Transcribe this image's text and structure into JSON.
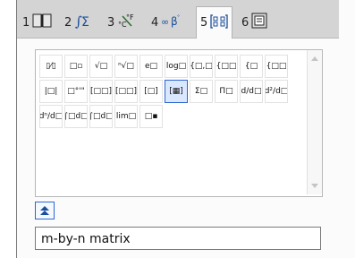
{
  "tabs": [
    {
      "number": "1",
      "icon": "book-icon"
    },
    {
      "number": "2",
      "icon": "integral-sum-icon"
    },
    {
      "number": "3",
      "icon": "unit-conversion-icon"
    },
    {
      "number": "4",
      "icon": "infinity-beta-icon"
    },
    {
      "number": "5",
      "icon": "matrix-template-icon",
      "active": true
    },
    {
      "number": "6",
      "icon": "catalog-icon"
    }
  ],
  "templates": [
    {
      "name": "fraction-template",
      "glyph": "▯⁄▯"
    },
    {
      "name": "exponent-template",
      "glyph": "□▫"
    },
    {
      "name": "square-root-template",
      "glyph": "√□"
    },
    {
      "name": "nth-root-template",
      "glyph": "ⁿ√□"
    },
    {
      "name": "e-exponent-template",
      "glyph": "e□"
    },
    {
      "name": "log-template",
      "glyph": "log□"
    },
    {
      "name": "piecewise-2-template",
      "glyph": "{□,□"
    },
    {
      "name": "piecewise-n-template",
      "glyph": "{□□"
    },
    {
      "name": "system-2-template",
      "glyph": "{□"
    },
    {
      "name": "system-n-template",
      "glyph": "{□□"
    },
    {
      "name": "absolute-value-template",
      "glyph": "|□|"
    },
    {
      "name": "dms-template",
      "glyph": "□°'\""
    },
    {
      "name": "matrix-2x2-template",
      "glyph": "[□□]"
    },
    {
      "name": "row-vector-template",
      "glyph": "[□□]"
    },
    {
      "name": "column-vector-template",
      "glyph": "[□]"
    },
    {
      "name": "matrix-m-by-n-template",
      "glyph": "[▦]",
      "selected": true
    },
    {
      "name": "sum-template",
      "glyph": "Σ□"
    },
    {
      "name": "product-template",
      "glyph": "Π□"
    },
    {
      "name": "first-derivative-template",
      "glyph": "d/d□"
    },
    {
      "name": "second-derivative-template",
      "glyph": "d²/d□"
    },
    {
      "name": "nth-derivative-template",
      "glyph": "dⁿ/d□"
    },
    {
      "name": "definite-integral-template",
      "glyph": "∫□d□"
    },
    {
      "name": "indefinite-integral-template",
      "glyph": "∫□d□"
    },
    {
      "name": "limit-template",
      "glyph": "lim□"
    },
    {
      "name": "subscript-template",
      "glyph": "□▪"
    }
  ],
  "collapse_button": {
    "icon": "collapse-up-icon"
  },
  "status": {
    "text": "m-by-n matrix"
  }
}
